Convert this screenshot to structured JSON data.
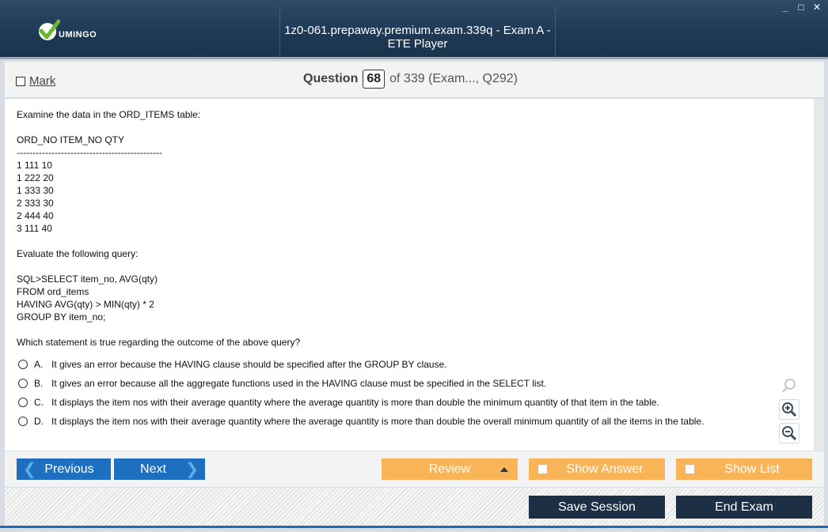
{
  "app": {
    "brand": "UMINGO",
    "window_title": "1z0-061.prepaway.premium.exam.339q - Exam A - ETE Player",
    "window_controls": {
      "minimize": "_",
      "maximize": "□",
      "close": "✕"
    }
  },
  "question_bar": {
    "mark_label": "Mark",
    "question_label": "Question",
    "question_number": "68",
    "question_of": "of 339 (Exam..., Q292)"
  },
  "question": {
    "intro": "Examine the data in the ORD_ITEMS table:",
    "table_header": "ORD_NO ITEM_NO QTY",
    "table_divider": "----------------------------------------------",
    "table_rows": [
      "1 111 10",
      "1 222 20",
      "1 333 30",
      "2 333 30",
      "2 444 40",
      "3 111 40"
    ],
    "evaluate": "Evaluate the following query:",
    "query_lines": [
      "SQL>SELECT item_no, AVG(qty)",
      "FROM ord_items",
      "HAVING AVG(qty) > MIN(qty) * 2",
      "GROUP BY item_no;"
    ],
    "prompt": "Which statement is true regarding the outcome of the above query?",
    "options": [
      {
        "letter": "A.",
        "text": "It gives an error because the HAVING clause should be specified after the GROUP BY clause."
      },
      {
        "letter": "B.",
        "text": "It gives an error because all the aggregate functions used in the HAVING clause must be specified in the SELECT list."
      },
      {
        "letter": "C.",
        "text": "It displays the item nos with their average quantity where the average quantity is more than double the minimum quantity of that item in the table."
      },
      {
        "letter": "D.",
        "text": "It displays the item nos with their average quantity where the average quantity is more than double the overall minimum quantity of all the items in the table."
      }
    ]
  },
  "nav": {
    "previous": "Previous",
    "next": "Next",
    "review": "Review",
    "show_answer": "Show Answer",
    "show_list": "Show List",
    "prev_chevron": "❮",
    "next_chevron": "❯"
  },
  "footer": {
    "save_session": "Save Session",
    "end_exam": "End Exam"
  },
  "colors": {
    "titlebar": "#1f3a56",
    "nav_blue": "#1e6fbf",
    "orange": "#f8b457",
    "dark_button": "#1c2f45",
    "logo_green": "#6ab830"
  },
  "icons": [
    "checkmark-logo-icon",
    "search-icon",
    "zoom-in-icon",
    "zoom-out-icon",
    "chevron-left-icon",
    "chevron-right-icon",
    "triangle-up-icon"
  ]
}
